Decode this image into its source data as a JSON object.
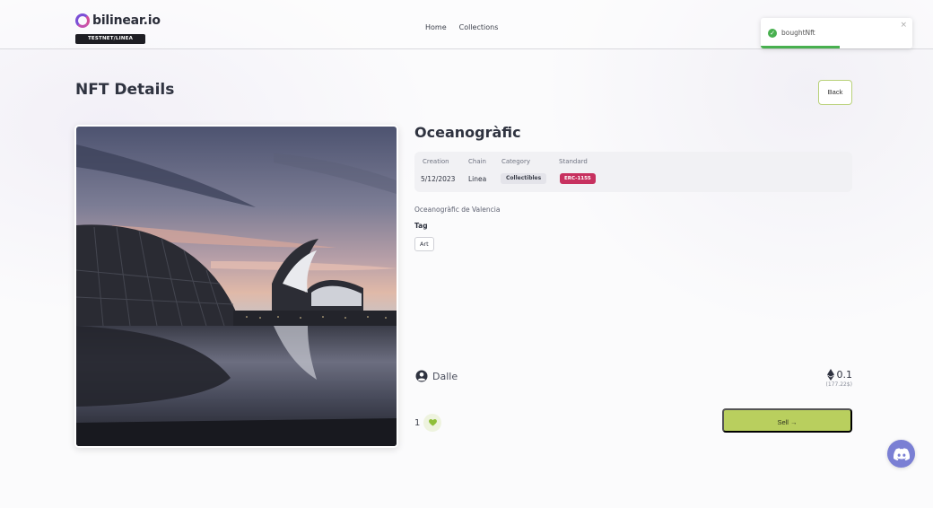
{
  "header": {
    "logo_text": "bilinear.io",
    "network_badge": "TESTNET/LINEA",
    "nav": [
      {
        "label": "Home"
      },
      {
        "label": "Collections"
      }
    ]
  },
  "toast": {
    "message": "boughtNft",
    "close_symbol": "×",
    "progress": 0.52,
    "status_color": "#48b04f"
  },
  "page": {
    "title": "NFT Details",
    "back_label": "Back"
  },
  "nft": {
    "name": "Oceanogràfic",
    "image_alt": "Oceanogràfic de Valencia",
    "meta": {
      "creation_label": "Creation",
      "creation_value": "5/12/2023",
      "chain_label": "Chain",
      "chain_value": "Linea",
      "category_label": "Category",
      "category_value": "Collectibles",
      "standard_label": "Standard",
      "standard_value": "ERC-1155"
    },
    "description": "Oceanogràfic de Valencia",
    "tag_heading": "Tag",
    "tags": [
      "Art"
    ],
    "owner": "Dalle",
    "price": "0.1",
    "price_usd": "(177.22$)",
    "likes": "1",
    "sell_label": "Sell →"
  },
  "colors": {
    "accent": "#b9cf5e",
    "standard_badge": "#c7315f",
    "discord": "#7a7fd4"
  },
  "icons": {
    "owner": "user-circle-icon",
    "currency": "ethereum-icon",
    "like": "heart-icon",
    "success": "check-circle-icon",
    "chat": "discord-icon"
  }
}
